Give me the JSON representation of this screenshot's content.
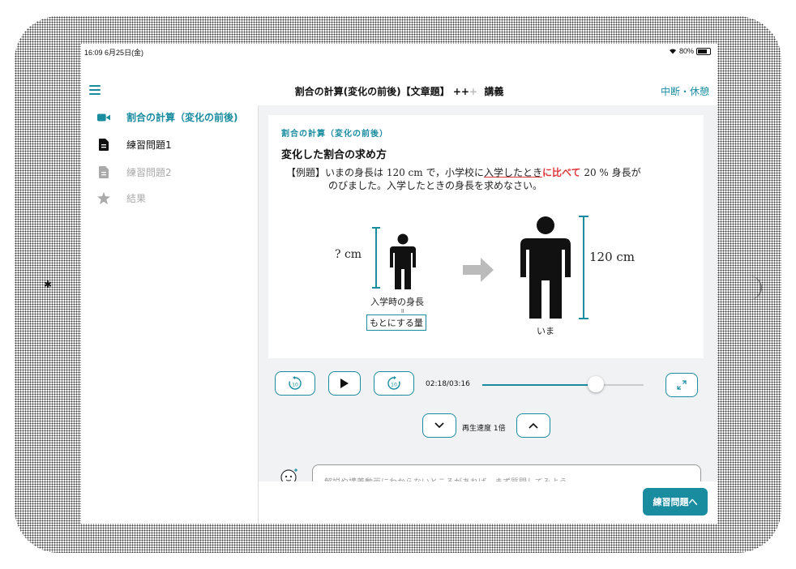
{
  "status_bar": {
    "time": "16:09",
    "date": "6月25日(金)",
    "battery": "80%"
  },
  "navbar": {
    "title": "割合の計算(変化の前後)【文章題】",
    "plus_filled": "++",
    "plus_empty": "+",
    "suffix": "講義",
    "right_action": "中断・休憩"
  },
  "sidebar": {
    "items": [
      {
        "label": "割合の計算（変化の前後)",
        "icon": "video-camera-icon",
        "state": "active"
      },
      {
        "label": "練習問題1",
        "icon": "document-icon",
        "state": "normal"
      },
      {
        "label": "練習問題2",
        "icon": "document-icon",
        "state": "disabled"
      },
      {
        "label": "結果",
        "icon": "star-icon",
        "state": "disabled"
      }
    ]
  },
  "slide": {
    "tag": "割合の計算（変化の前後）",
    "heading": "変化した割合の求め方",
    "q_line1_a": "【例題】いまの身長は 120 cm で，小学校に",
    "q_line1_b": "入学したとき",
    "q_line1_c": "に比べて",
    "q_line1_d": " 20 % 身長が",
    "q_line2": "のびました。入学したときの身長を求めなさい。",
    "left_value": "? cm",
    "left_caption": "入学時の身長",
    "equals": "॥",
    "base_box": "もとにする量",
    "right_value": "120 cm",
    "right_caption": "いま"
  },
  "player": {
    "timecode": "02:18/03:16",
    "progress": 0.706,
    "rewind_seconds": "10",
    "forward_seconds": "10",
    "speed_label": "再生速度 1倍"
  },
  "comment": {
    "placeholder": "解説や講義動画にわからないところがあれば、まず質問してみよう。"
  },
  "next_button": "練習問題へ",
  "colors": {
    "accent": "#1a8ca0",
    "highlight": "#e0353b"
  }
}
